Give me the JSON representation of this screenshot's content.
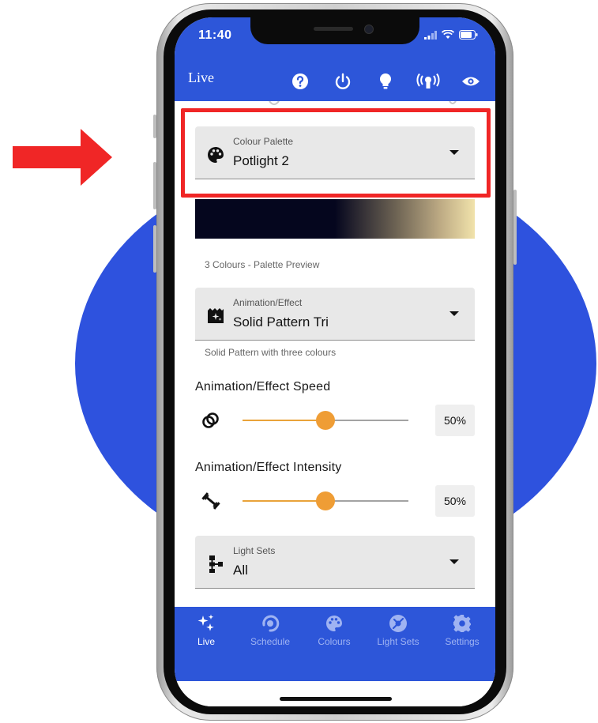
{
  "status_bar": {
    "time": "11:40"
  },
  "app_bar": {
    "title": "Live",
    "icons": [
      "help-icon",
      "power-icon",
      "lightbulb-icon",
      "broadcast-icon",
      "eye-icon"
    ]
  },
  "colour_palette": {
    "label": "Colour Palette",
    "value": "Potlight 2",
    "preview_caption": "3 Colours - Palette Preview",
    "preview_colors": [
      "#05061e",
      "#6e6454",
      "#f1e3ab"
    ]
  },
  "animation": {
    "label": "Animation/Effect",
    "value": "Solid Pattern Tri",
    "description": "Solid Pattern with three colours"
  },
  "speed": {
    "title": "Animation/Effect Speed",
    "value_label": "50%",
    "value": 50
  },
  "intensity": {
    "title": "Animation/Effect Intensity",
    "value_label": "50%",
    "value": 50
  },
  "light_sets": {
    "label": "Light Sets",
    "value": "All"
  },
  "tabs": [
    {
      "label": "Live",
      "icon": "sparkles-icon",
      "active": true
    },
    {
      "label": "Schedule",
      "icon": "schedule-icon",
      "active": false
    },
    {
      "label": "Colours",
      "icon": "palette-icon",
      "active": false
    },
    {
      "label": "Light Sets",
      "icon": "light-sets-icon",
      "active": false
    },
    {
      "label": "Settings",
      "icon": "gear-icon",
      "active": false
    }
  ],
  "colors": {
    "brand_blue": "#2d56d9",
    "slider_orange": "#ef9d35",
    "highlight_red": "#f02626",
    "arrow_red": "#f02626"
  }
}
